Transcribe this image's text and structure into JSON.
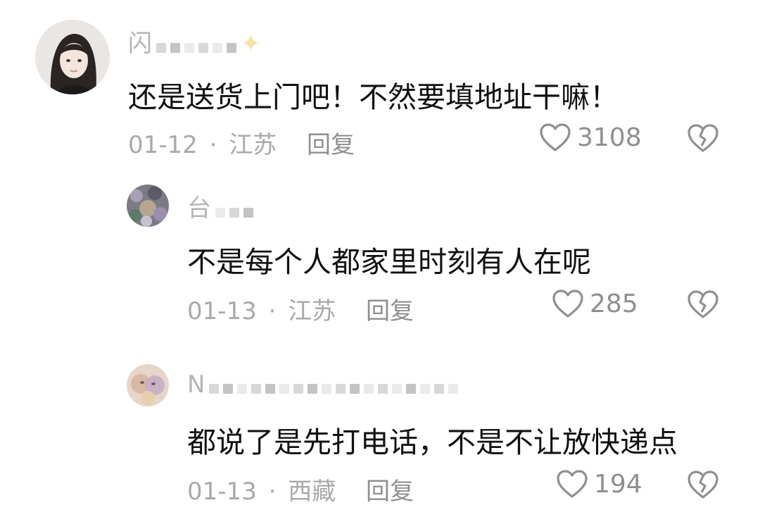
{
  "comments": [
    {
      "username": "闪",
      "text": "还是送货上门吧！不然要填地址干嘛！",
      "date": "01-12",
      "location": "江苏",
      "reply_label": "回复",
      "likes": "3108"
    },
    {
      "username": "台",
      "text": "不是每个人都家里时刻有人在呢",
      "date": "01-13",
      "location": "江苏",
      "reply_label": "回复",
      "likes": "285"
    },
    {
      "username": "N",
      "text": "都说了是先打电话，不是不让放快递点",
      "date": "01-13",
      "location": "西藏",
      "reply_label": "回复",
      "likes": "194"
    }
  ],
  "meta_separator": "·",
  "colors": {
    "meta_gray": "#a9a9a9",
    "text": "#111111",
    "icon_gray": "#8f8f8f"
  },
  "icons": {
    "like": "heart-outline-icon",
    "dislike": "broken-heart-icon"
  }
}
